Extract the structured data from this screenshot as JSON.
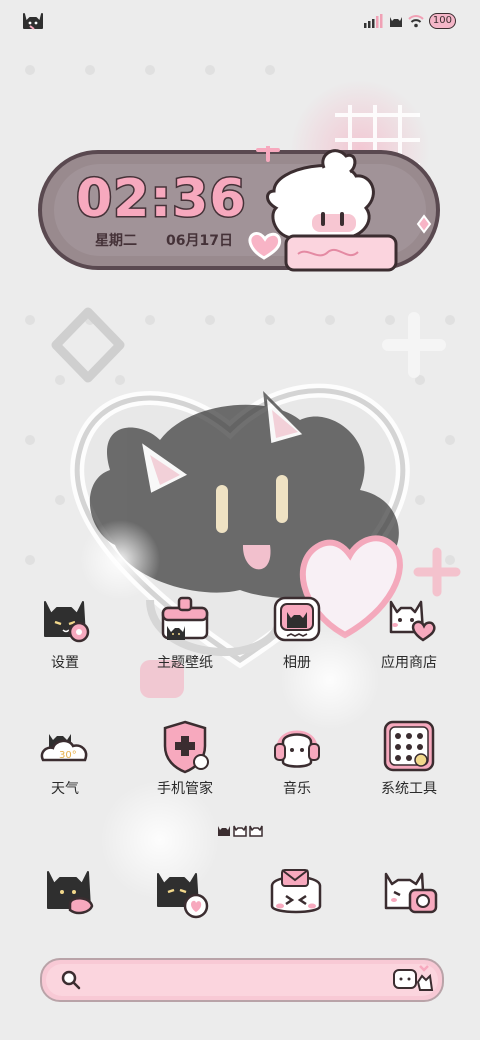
{
  "status_bar": {
    "battery": "100"
  },
  "clock": {
    "time": "02:36",
    "weekday": "星期二",
    "date": "06月17日"
  },
  "apps": [
    {
      "label": "设置",
      "icon": "settings-cat-icon"
    },
    {
      "label": "主题壁纸",
      "icon": "theme-wallpaper-icon"
    },
    {
      "label": "相册",
      "icon": "gallery-icon"
    },
    {
      "label": "应用商店",
      "icon": "app-store-icon"
    },
    {
      "label": "天气",
      "icon": "weather-icon"
    },
    {
      "label": "手机管家",
      "icon": "phone-manager-icon"
    },
    {
      "label": "音乐",
      "icon": "music-icon"
    },
    {
      "label": "系统工具",
      "icon": "system-tools-icon"
    }
  ],
  "dock": [
    {
      "icon": "phone-cat-icon"
    },
    {
      "icon": "messages-cat-icon"
    },
    {
      "icon": "mail-cat-icon"
    },
    {
      "icon": "camera-cat-icon"
    }
  ],
  "page_indicator": {
    "pages": 3,
    "current": 1
  },
  "search": {
    "icon": "search-icon"
  },
  "colors": {
    "accent_pink": "#f7a9be",
    "dark_outline": "#453238",
    "background": "#ececec"
  }
}
